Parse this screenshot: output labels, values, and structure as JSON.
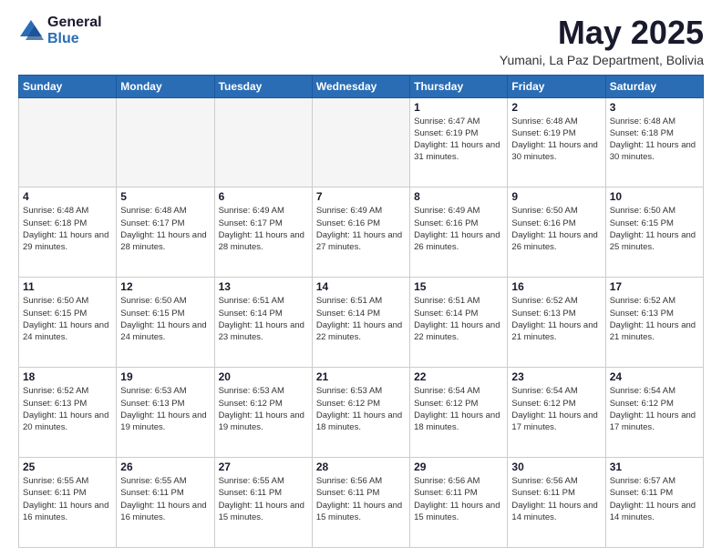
{
  "header": {
    "logo_general": "General",
    "logo_blue": "Blue",
    "month_title": "May 2025",
    "subtitle": "Yumani, La Paz Department, Bolivia"
  },
  "days_of_week": [
    "Sunday",
    "Monday",
    "Tuesday",
    "Wednesday",
    "Thursday",
    "Friday",
    "Saturday"
  ],
  "weeks": [
    [
      {
        "day": "",
        "empty": true
      },
      {
        "day": "",
        "empty": true
      },
      {
        "day": "",
        "empty": true
      },
      {
        "day": "",
        "empty": true
      },
      {
        "day": "1",
        "sunrise": "6:47 AM",
        "sunset": "6:19 PM",
        "daylight": "11 hours and 31 minutes."
      },
      {
        "day": "2",
        "sunrise": "6:48 AM",
        "sunset": "6:19 PM",
        "daylight": "11 hours and 30 minutes."
      },
      {
        "day": "3",
        "sunrise": "6:48 AM",
        "sunset": "6:18 PM",
        "daylight": "11 hours and 30 minutes."
      }
    ],
    [
      {
        "day": "4",
        "sunrise": "6:48 AM",
        "sunset": "6:18 PM",
        "daylight": "11 hours and 29 minutes."
      },
      {
        "day": "5",
        "sunrise": "6:48 AM",
        "sunset": "6:17 PM",
        "daylight": "11 hours and 28 minutes."
      },
      {
        "day": "6",
        "sunrise": "6:49 AM",
        "sunset": "6:17 PM",
        "daylight": "11 hours and 28 minutes."
      },
      {
        "day": "7",
        "sunrise": "6:49 AM",
        "sunset": "6:16 PM",
        "daylight": "11 hours and 27 minutes."
      },
      {
        "day": "8",
        "sunrise": "6:49 AM",
        "sunset": "6:16 PM",
        "daylight": "11 hours and 26 minutes."
      },
      {
        "day": "9",
        "sunrise": "6:50 AM",
        "sunset": "6:16 PM",
        "daylight": "11 hours and 26 minutes."
      },
      {
        "day": "10",
        "sunrise": "6:50 AM",
        "sunset": "6:15 PM",
        "daylight": "11 hours and 25 minutes."
      }
    ],
    [
      {
        "day": "11",
        "sunrise": "6:50 AM",
        "sunset": "6:15 PM",
        "daylight": "11 hours and 24 minutes."
      },
      {
        "day": "12",
        "sunrise": "6:50 AM",
        "sunset": "6:15 PM",
        "daylight": "11 hours and 24 minutes."
      },
      {
        "day": "13",
        "sunrise": "6:51 AM",
        "sunset": "6:14 PM",
        "daylight": "11 hours and 23 minutes."
      },
      {
        "day": "14",
        "sunrise": "6:51 AM",
        "sunset": "6:14 PM",
        "daylight": "11 hours and 22 minutes."
      },
      {
        "day": "15",
        "sunrise": "6:51 AM",
        "sunset": "6:14 PM",
        "daylight": "11 hours and 22 minutes."
      },
      {
        "day": "16",
        "sunrise": "6:52 AM",
        "sunset": "6:13 PM",
        "daylight": "11 hours and 21 minutes."
      },
      {
        "day": "17",
        "sunrise": "6:52 AM",
        "sunset": "6:13 PM",
        "daylight": "11 hours and 21 minutes."
      }
    ],
    [
      {
        "day": "18",
        "sunrise": "6:52 AM",
        "sunset": "6:13 PM",
        "daylight": "11 hours and 20 minutes."
      },
      {
        "day": "19",
        "sunrise": "6:53 AM",
        "sunset": "6:13 PM",
        "daylight": "11 hours and 19 minutes."
      },
      {
        "day": "20",
        "sunrise": "6:53 AM",
        "sunset": "6:12 PM",
        "daylight": "11 hours and 19 minutes."
      },
      {
        "day": "21",
        "sunrise": "6:53 AM",
        "sunset": "6:12 PM",
        "daylight": "11 hours and 18 minutes."
      },
      {
        "day": "22",
        "sunrise": "6:54 AM",
        "sunset": "6:12 PM",
        "daylight": "11 hours and 18 minutes."
      },
      {
        "day": "23",
        "sunrise": "6:54 AM",
        "sunset": "6:12 PM",
        "daylight": "11 hours and 17 minutes."
      },
      {
        "day": "24",
        "sunrise": "6:54 AM",
        "sunset": "6:12 PM",
        "daylight": "11 hours and 17 minutes."
      }
    ],
    [
      {
        "day": "25",
        "sunrise": "6:55 AM",
        "sunset": "6:11 PM",
        "daylight": "11 hours and 16 minutes."
      },
      {
        "day": "26",
        "sunrise": "6:55 AM",
        "sunset": "6:11 PM",
        "daylight": "11 hours and 16 minutes."
      },
      {
        "day": "27",
        "sunrise": "6:55 AM",
        "sunset": "6:11 PM",
        "daylight": "11 hours and 15 minutes."
      },
      {
        "day": "28",
        "sunrise": "6:56 AM",
        "sunset": "6:11 PM",
        "daylight": "11 hours and 15 minutes."
      },
      {
        "day": "29",
        "sunrise": "6:56 AM",
        "sunset": "6:11 PM",
        "daylight": "11 hours and 15 minutes."
      },
      {
        "day": "30",
        "sunrise": "6:56 AM",
        "sunset": "6:11 PM",
        "daylight": "11 hours and 14 minutes."
      },
      {
        "day": "31",
        "sunrise": "6:57 AM",
        "sunset": "6:11 PM",
        "daylight": "11 hours and 14 minutes."
      }
    ]
  ]
}
